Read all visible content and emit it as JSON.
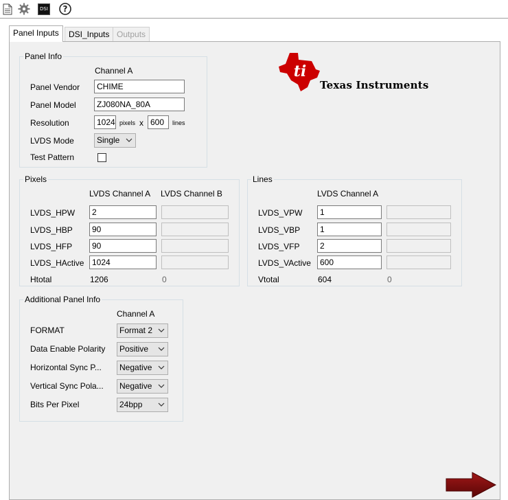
{
  "toolbar": {
    "icons": [
      "document-icon",
      "gear-icon",
      "dsi-icon",
      "help-icon"
    ],
    "dsi_icon_text": "DSI"
  },
  "tabs": [
    {
      "label": "Panel Inputs",
      "state": "active"
    },
    {
      "label": "DSI_Inputs",
      "state": "normal"
    },
    {
      "label": "Outputs",
      "state": "disabled"
    }
  ],
  "logo": {
    "text": "Texas Instruments",
    "color": "#cc0000"
  },
  "panel_info": {
    "title": "Panel Info",
    "channel_header": "Channel A",
    "vendor_label": "Panel Vendor",
    "vendor_value": "CHIME",
    "model_label": "Panel Model",
    "model_value": "ZJ080NA_80A",
    "resolution_label": "Resolution",
    "res_width": "1024",
    "pixels_unit": "pixels",
    "times": "x",
    "res_height": "600",
    "lines_unit": "lines",
    "lvds_mode_label": "LVDS Mode",
    "lvds_mode_value": "Single",
    "test_pattern_label": "Test Pattern",
    "test_pattern_checked": false
  },
  "pixels": {
    "title": "Pixels",
    "header_a": "LVDS Channel A",
    "header_b": "LVDS Channel B",
    "rows": [
      {
        "label": "LVDS_HPW",
        "a": "2",
        "b": ""
      },
      {
        "label": "LVDS_HBP",
        "a": "90",
        "b": ""
      },
      {
        "label": "LVDS_HFP",
        "a": "90",
        "b": ""
      },
      {
        "label": "LVDS_HActive",
        "a": "1024",
        "b": ""
      }
    ],
    "total_label": "Htotal",
    "total_a": "1206",
    "total_b": "0"
  },
  "lines": {
    "title": "Lines",
    "header_a": "LVDS Channel A",
    "rows": [
      {
        "label": "LVDS_VPW",
        "a": "1",
        "b": ""
      },
      {
        "label": "LVDS_VBP",
        "a": "1",
        "b": ""
      },
      {
        "label": "LVDS_VFP",
        "a": "2",
        "b": ""
      },
      {
        "label": "LVDS_VActive",
        "a": "600",
        "b": ""
      }
    ],
    "total_label": "Vtotal",
    "total_a": "604",
    "total_b": "0"
  },
  "additional": {
    "title": "Additional Panel Info",
    "channel_header": "Channel A",
    "rows": [
      {
        "label": "FORMAT",
        "value": "Format 2"
      },
      {
        "label": "Data Enable Polarity",
        "value": "Positive"
      },
      {
        "label": "Horizontal Sync P...",
        "value": "Negative"
      },
      {
        "label": "Vertical Sync Pola...",
        "value": "Negative"
      },
      {
        "label": "Bits Per Pixel",
        "value": "24bpp"
      }
    ]
  },
  "next_arrow": {
    "icon": "next-arrow-icon",
    "color": "#7a0a0a"
  }
}
